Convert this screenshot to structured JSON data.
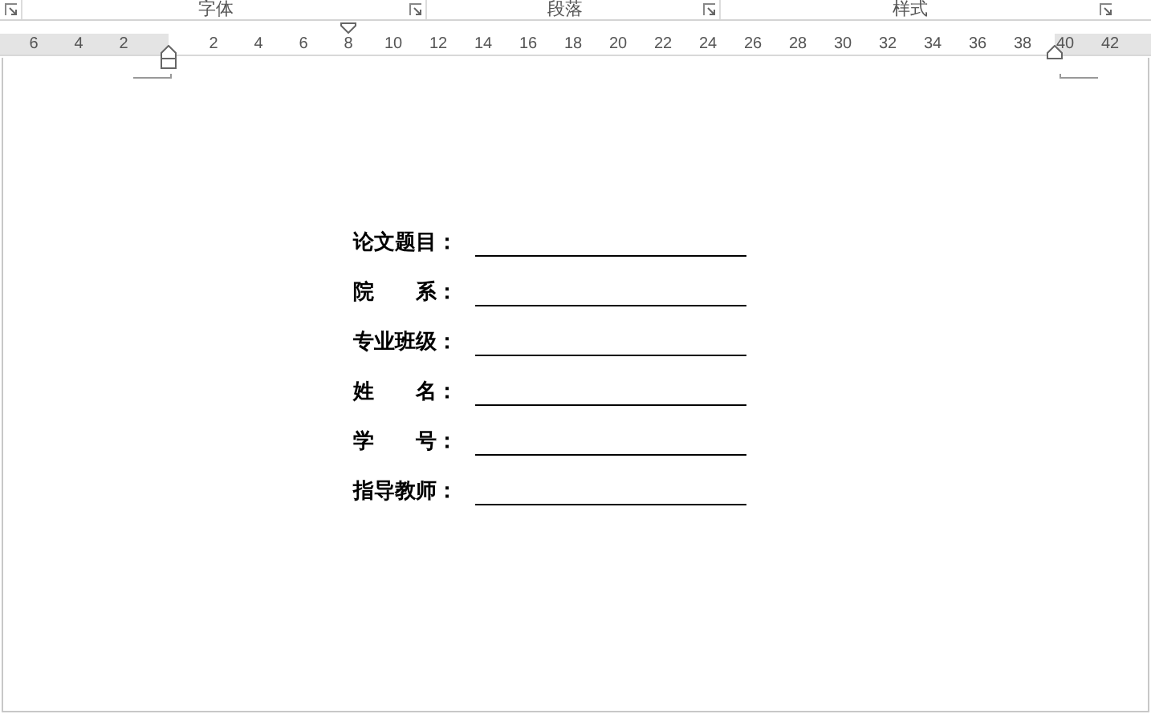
{
  "ribbon_groups": [
    {
      "label": "字体"
    },
    {
      "label": "段落"
    },
    {
      "label": "样式"
    }
  ],
  "ruler": {
    "left_margin_labels": [
      "6",
      "4",
      "2"
    ],
    "body_labels": [
      "2",
      "4",
      "6",
      "8",
      "10",
      "12",
      "14",
      "16",
      "18",
      "20",
      "22",
      "24",
      "26",
      "28",
      "30",
      "32",
      "34",
      "36",
      "38"
    ],
    "right_margin_labels": [
      "40",
      "42"
    ]
  },
  "form_fields": [
    {
      "label": "论文题目："
    },
    {
      "label": "院　　系："
    },
    {
      "label": "专业班级："
    },
    {
      "label": "姓　　名："
    },
    {
      "label": "学　　号："
    },
    {
      "label": "指导教师："
    }
  ]
}
